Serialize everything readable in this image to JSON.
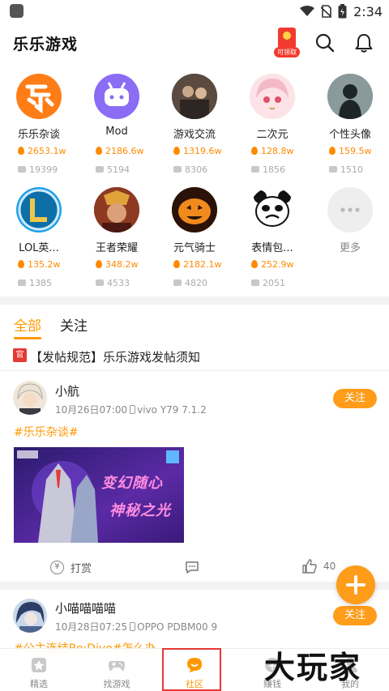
{
  "status_bar": {
    "time": "2:34"
  },
  "header": {
    "title": "乐乐游戏",
    "red_packet_label": "可领取"
  },
  "categories": [
    {
      "name": "乐乐杂谈",
      "heat": "2653.1w",
      "posts": "19399"
    },
    {
      "name": "Mod",
      "heat": "2186.6w",
      "posts": "5194"
    },
    {
      "name": "游戏交流",
      "heat": "1319.6w",
      "posts": "8306"
    },
    {
      "name": "二次元",
      "heat": "128.8w",
      "posts": "1856"
    },
    {
      "name": "个性头像",
      "heat": "159.5w",
      "posts": "1510"
    },
    {
      "name": "LOL英...",
      "heat": "135.2w",
      "posts": "1385"
    },
    {
      "name": "王者荣耀",
      "heat": "348.2w",
      "posts": "4533"
    },
    {
      "name": "元气骑士",
      "heat": "2182.1w",
      "posts": "4820"
    },
    {
      "name": "表情包...",
      "heat": "252.9w",
      "posts": "2051"
    },
    {
      "name": "更多"
    }
  ],
  "feed_tabs": {
    "all": "全部",
    "follow": "关注"
  },
  "rule_notice": {
    "badge": "官",
    "text": "【发帖规范】乐乐游戏发帖须知"
  },
  "posts": [
    {
      "author": "小航",
      "time": "10月26日07:00",
      "device": "vivo Y79 7.1.2",
      "follow_label": "关注",
      "topic": "#乐乐杂谈#",
      "image_text_1": "变幻随心",
      "image_text_2": "神秘之光",
      "reward_label": "打赏",
      "likes": "40"
    },
    {
      "author": "小喵喵喵喵",
      "time": "10月28日07:25",
      "device": "OPPO PDBM00 9",
      "follow_label": "关注",
      "topic": "#公主连结Re:Dive#怎么办"
    }
  ],
  "bottom_nav": [
    {
      "label": "精选"
    },
    {
      "label": "找游戏"
    },
    {
      "label": "社区",
      "active": true
    },
    {
      "label": "赚钱"
    },
    {
      "label": "我的"
    }
  ],
  "watermark": "大玩家",
  "colors": {
    "accent": "#ff9800",
    "follow_button": "#ff9c1a",
    "official_badge": "#e53935"
  }
}
